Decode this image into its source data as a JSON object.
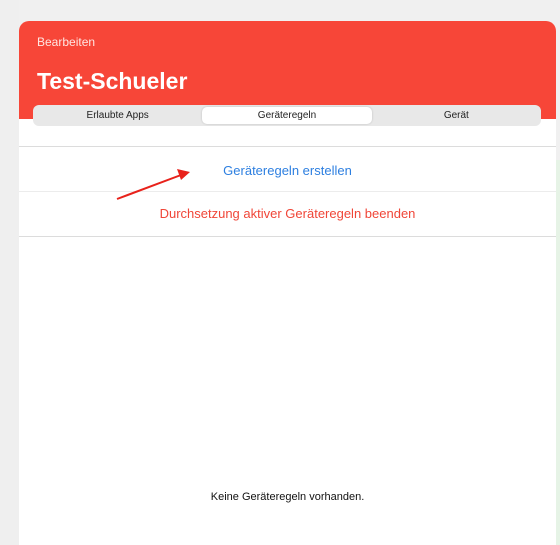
{
  "header": {
    "edit_label": "Bearbeiten",
    "title": "Test-Schueler",
    "background_color": "#f74638"
  },
  "tabs": [
    {
      "label": "Erlaubte Apps",
      "active": false
    },
    {
      "label": "Geräteregeln",
      "active": true
    },
    {
      "label": "Gerät",
      "active": false
    }
  ],
  "actions": {
    "create_rules": "Geräteregeln erstellen",
    "stop_enforcement": "Durchsetzung aktiver Geräteregeln beenden"
  },
  "empty_state": "Keine Geräteregeln vorhanden.",
  "annotation": {
    "type": "red-arrow",
    "points_to": "create_rules",
    "color": "#e8221b"
  }
}
